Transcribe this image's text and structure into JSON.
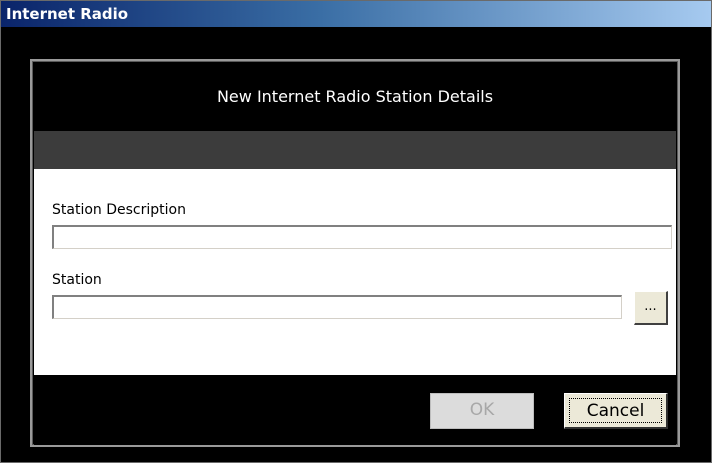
{
  "window": {
    "title": "Internet Radio"
  },
  "dialog": {
    "header_title": "New Internet Radio Station Details",
    "fields": {
      "description_label": "Station Description",
      "description_value": "",
      "station_label": "Station",
      "station_value": ""
    },
    "browse_label": "...",
    "buttons": {
      "ok_label": "OK",
      "ok_enabled": false,
      "cancel_label": "Cancel"
    }
  }
}
